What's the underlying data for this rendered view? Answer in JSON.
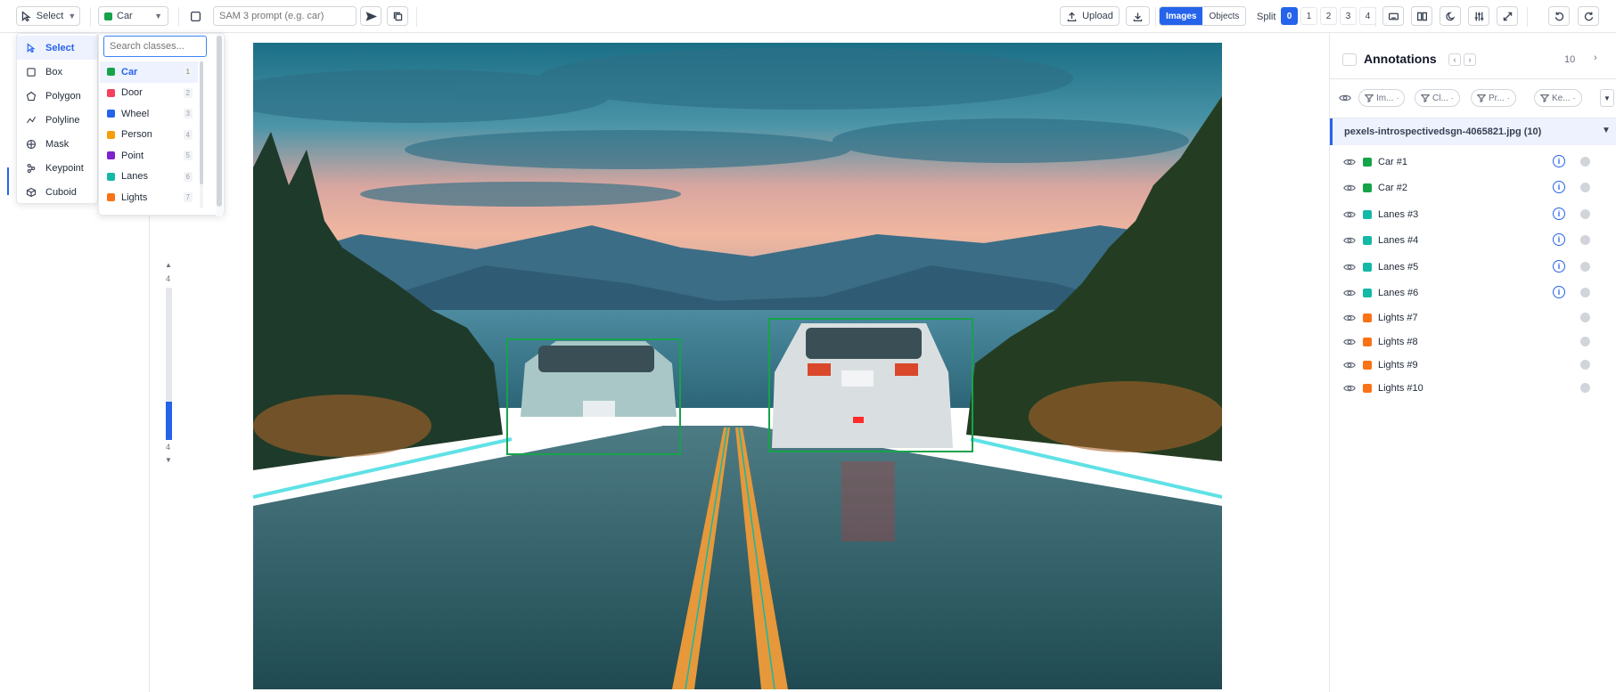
{
  "toolbar": {
    "tool_select_label": "Select",
    "class_select_label": "Car",
    "class_select_color": "#16a34a",
    "prompt_placeholder": "SAM 3 prompt (e.g. car)",
    "upload_label": "Upload",
    "view_modes": [
      "Images",
      "Objects"
    ],
    "active_view_mode": "Images",
    "split_label": "Split",
    "split_options": [
      "0",
      "1",
      "2",
      "3",
      "4"
    ],
    "active_split": "0",
    "icons": [
      "send-icon",
      "copy-icon",
      "upload-icon",
      "download-icon",
      "keyboard-icon",
      "book-icon",
      "moon-icon",
      "sliders-icon",
      "expand-icon",
      "undo-icon",
      "redo-icon"
    ]
  },
  "tool_menu": {
    "items": [
      {
        "label": "Select",
        "icon": "pointer-icon",
        "active": true
      },
      {
        "label": "Box",
        "icon": "box-icon"
      },
      {
        "label": "Polygon",
        "icon": "polygon-icon"
      },
      {
        "label": "Polyline",
        "icon": "polyline-icon"
      },
      {
        "label": "Mask",
        "icon": "mask-icon"
      },
      {
        "label": "Keypoint",
        "icon": "keypoint-icon"
      },
      {
        "label": "Cuboid",
        "icon": "cuboid-icon"
      }
    ]
  },
  "class_menu": {
    "search_placeholder": "Search classes...",
    "items": [
      {
        "label": "Car",
        "count": "1",
        "color": "#16a34a",
        "active": true
      },
      {
        "label": "Door",
        "count": "2",
        "color": "#f43f5e"
      },
      {
        "label": "Wheel",
        "count": "3",
        "color": "#2563eb"
      },
      {
        "label": "Person",
        "count": "4",
        "color": "#f59e0b"
      },
      {
        "label": "Point",
        "count": "5",
        "color": "#7e22ce"
      },
      {
        "label": "Lanes",
        "count": "6",
        "color": "#14b8a6"
      },
      {
        "label": "Lights",
        "count": "7",
        "color": "#f97316"
      }
    ]
  },
  "frame_slider": {
    "top_value": "4",
    "bottom_value": "4"
  },
  "annotations_panel": {
    "title": "Annotations",
    "count": "10",
    "filters": [
      "Im...",
      "Cl...",
      "Pr...",
      "Ke..."
    ],
    "file_label": "pexels-introspectivedsgn-4065821.jpg (10)",
    "items": [
      {
        "label": "Car #1",
        "color": "#16a34a",
        "info": true
      },
      {
        "label": "Car #2",
        "color": "#16a34a",
        "info": true
      },
      {
        "label": "Lanes #3",
        "color": "#14b8a6",
        "info": true
      },
      {
        "label": "Lanes #4",
        "color": "#14b8a6",
        "info": true
      },
      {
        "label": "Lanes #5",
        "color": "#14b8a6",
        "info": true
      },
      {
        "label": "Lanes #6",
        "color": "#14b8a6",
        "info": true
      },
      {
        "label": "Lights #7",
        "color": "#f97316",
        "info": false
      },
      {
        "label": "Lights #8",
        "color": "#f97316",
        "info": false
      },
      {
        "label": "Lights #9",
        "color": "#f97316",
        "info": false
      },
      {
        "label": "Lights #10",
        "color": "#f97316",
        "info": false
      }
    ]
  },
  "colors": {
    "accent": "#2563eb",
    "box_car": "#16a34a",
    "lane": "#14b8a6"
  }
}
